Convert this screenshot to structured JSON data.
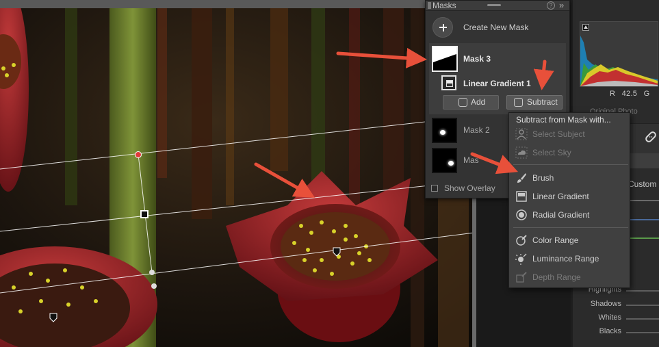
{
  "masks_panel": {
    "title": "Masks",
    "help_glyph": "?",
    "expand_glyph": "»",
    "create_label": "Create New Mask",
    "mask3": {
      "label": "Mask 3"
    },
    "component": {
      "label": "Linear Gradient 1"
    },
    "add_label": "Add",
    "subtract_label": "Subtract",
    "mask2": {
      "label": "Mask 2"
    },
    "mask1": {
      "label": "Mas"
    },
    "show_overlay_label": "Show Overlay",
    "show_overlay_checked": false
  },
  "subtract_menu": {
    "title": "Subtract from Mask with...",
    "items": [
      {
        "label": "Select Subject",
        "icon": "person-select-icon",
        "enabled": false
      },
      {
        "label": "Select Sky",
        "icon": "sky-select-icon",
        "enabled": false
      },
      {
        "label": "Brush",
        "icon": "brush-icon",
        "enabled": true
      },
      {
        "label": "Linear Gradient",
        "icon": "linear-gradient-icon",
        "enabled": true
      },
      {
        "label": "Radial Gradient",
        "icon": "radial-gradient-icon",
        "enabled": true
      },
      {
        "label": "Color Range",
        "icon": "color-range-icon",
        "enabled": true
      },
      {
        "label": "Luminance Range",
        "icon": "luminance-range-icon",
        "enabled": true
      },
      {
        "label": "Depth Range",
        "icon": "depth-range-icon",
        "enabled": false
      }
    ]
  },
  "develop_panel": {
    "rgb_readout": {
      "r_label": "R",
      "r_value": "42.5",
      "g_label": "G"
    },
    "orig_label": "Original Photo",
    "custom_label": "Custom",
    "tone_labels": [
      "Highlights",
      "Shadows",
      "Whites",
      "Blacks"
    ]
  },
  "colors": {
    "accent_red": "#e8503a",
    "panel_bg": "#333333",
    "menu_bg": "#404040"
  }
}
